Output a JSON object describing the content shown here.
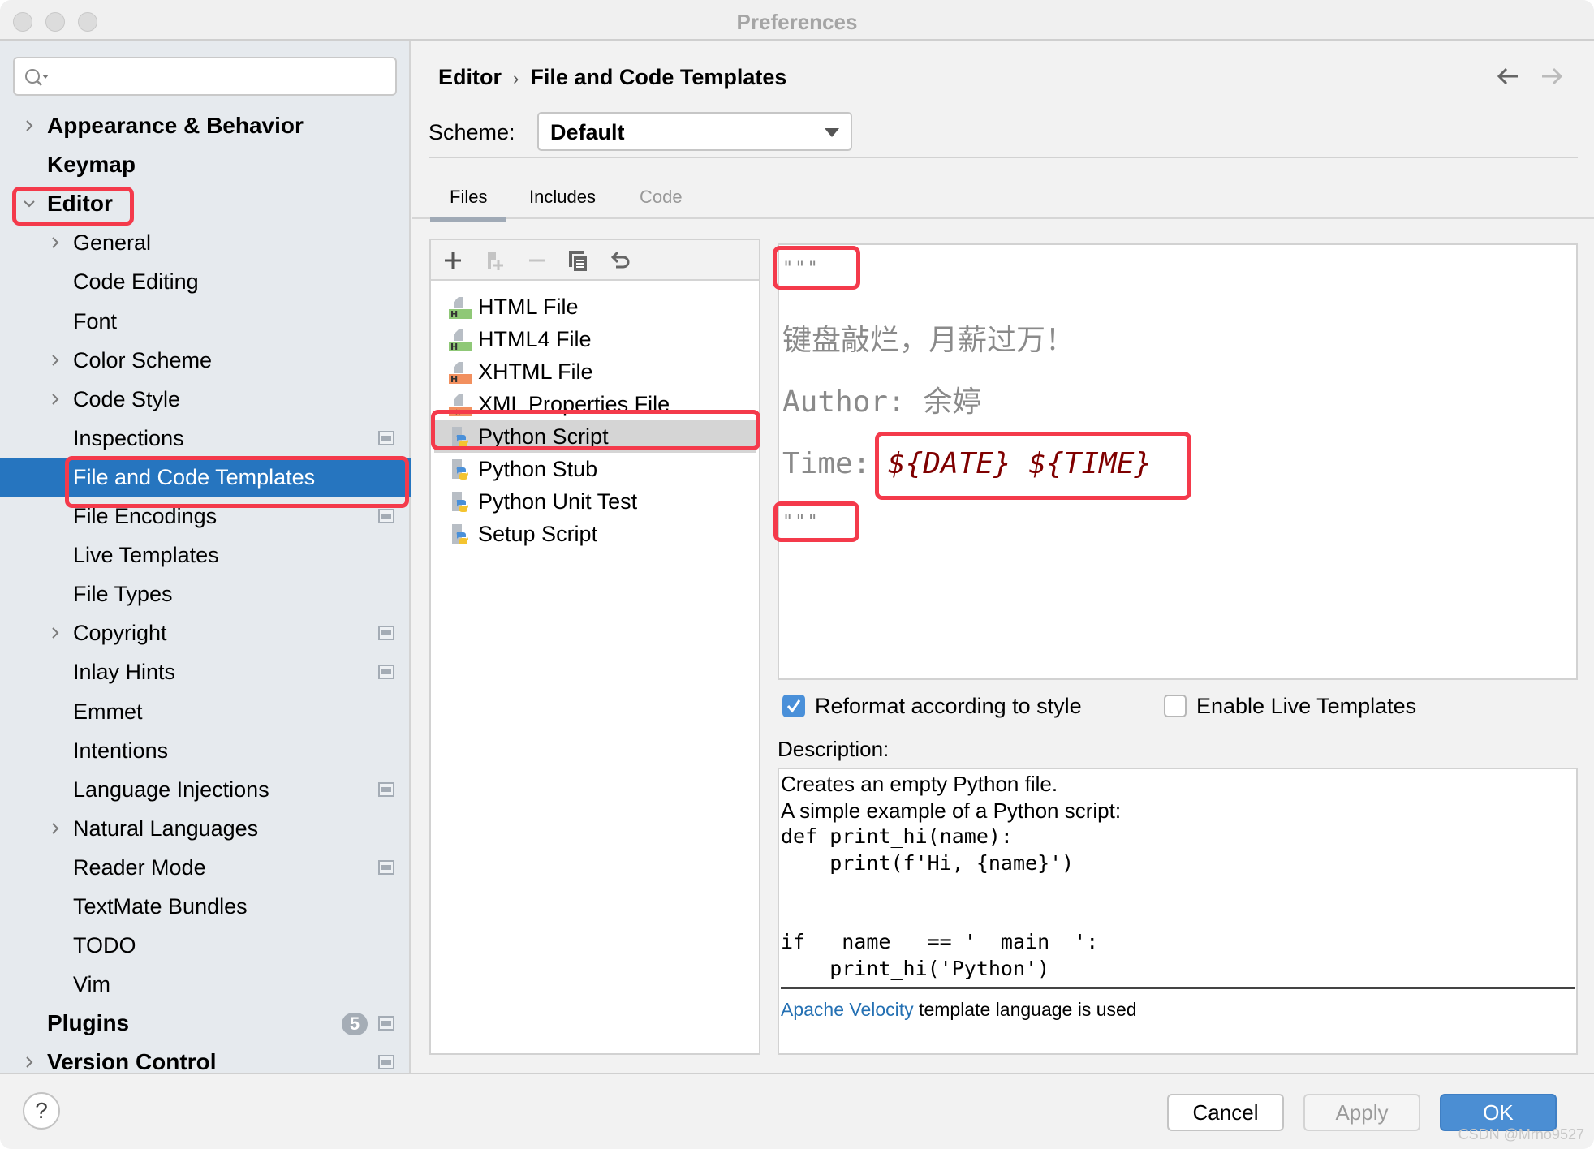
{
  "window": {
    "title": "Preferences"
  },
  "search": {
    "placeholder": "",
    "value": ""
  },
  "sidebar": {
    "items": [
      {
        "label": "Appearance & Behavior",
        "level": 0,
        "expandable": true,
        "expanded": false,
        "scope": false
      },
      {
        "label": "Keymap",
        "level": 0,
        "expandable": false,
        "scope": false
      },
      {
        "label": "Editor",
        "level": 0,
        "expandable": true,
        "expanded": true,
        "scope": false
      },
      {
        "label": "General",
        "level": 1,
        "expandable": true,
        "expanded": false,
        "scope": false
      },
      {
        "label": "Code Editing",
        "level": 1,
        "expandable": false,
        "scope": false
      },
      {
        "label": "Font",
        "level": 1,
        "expandable": false,
        "scope": false
      },
      {
        "label": "Color Scheme",
        "level": 1,
        "expandable": true,
        "expanded": false,
        "scope": false
      },
      {
        "label": "Code Style",
        "level": 1,
        "expandable": true,
        "expanded": false,
        "scope": false
      },
      {
        "label": "Inspections",
        "level": 1,
        "expandable": false,
        "scope": true
      },
      {
        "label": "File and Code Templates",
        "level": 1,
        "expandable": false,
        "scope": false,
        "selected": true
      },
      {
        "label": "File Encodings",
        "level": 1,
        "expandable": false,
        "scope": true
      },
      {
        "label": "Live Templates",
        "level": 1,
        "expandable": false,
        "scope": false
      },
      {
        "label": "File Types",
        "level": 1,
        "expandable": false,
        "scope": false
      },
      {
        "label": "Copyright",
        "level": 1,
        "expandable": true,
        "expanded": false,
        "scope": true
      },
      {
        "label": "Inlay Hints",
        "level": 1,
        "expandable": false,
        "scope": true
      },
      {
        "label": "Emmet",
        "level": 1,
        "expandable": false,
        "scope": false
      },
      {
        "label": "Intentions",
        "level": 1,
        "expandable": false,
        "scope": false
      },
      {
        "label": "Language Injections",
        "level": 1,
        "expandable": false,
        "scope": true
      },
      {
        "label": "Natural Languages",
        "level": 1,
        "expandable": true,
        "expanded": false,
        "scope": false
      },
      {
        "label": "Reader Mode",
        "level": 1,
        "expandable": false,
        "scope": true
      },
      {
        "label": "TextMate Bundles",
        "level": 1,
        "expandable": false,
        "scope": false
      },
      {
        "label": "TODO",
        "level": 1,
        "expandable": false,
        "scope": false
      },
      {
        "label": "Vim",
        "level": 1,
        "expandable": false,
        "scope": false
      },
      {
        "label": "Plugins",
        "level": 0,
        "expandable": false,
        "scope": true,
        "badge": "5"
      },
      {
        "label": "Version Control",
        "level": 0,
        "expandable": true,
        "expanded": false,
        "scope": true
      }
    ]
  },
  "header": {
    "breadcrumb": [
      "Editor",
      "File and Code Templates"
    ],
    "breadcrumb_separator": "›",
    "back_icon": "arrow-left-icon",
    "forward_icon": "arrow-right-icon"
  },
  "scheme": {
    "label": "Scheme:",
    "value": "Default"
  },
  "tabs": [
    {
      "label": "Files",
      "active": true,
      "enabled": true
    },
    {
      "label": "Includes",
      "active": false,
      "enabled": true
    },
    {
      "label": "Code",
      "active": false,
      "enabled": false
    }
  ],
  "toolbar": {
    "icons": [
      "add-icon",
      "add-child-icon",
      "remove-icon",
      "copy-icon",
      "reset-icon"
    ]
  },
  "templates": [
    {
      "label": "HTML File",
      "icon": "html",
      "selected": false
    },
    {
      "label": "HTML4 File",
      "icon": "html",
      "selected": false
    },
    {
      "label": "XHTML File",
      "icon": "xhtml",
      "selected": false
    },
    {
      "label": "XML Properties File",
      "icon": "xml",
      "selected": false
    },
    {
      "label": "Python Script",
      "icon": "python",
      "selected": true
    },
    {
      "label": "Python Stub",
      "icon": "python",
      "selected": false
    },
    {
      "label": "Python Unit Test",
      "icon": "python",
      "selected": false
    },
    {
      "label": "Setup Script",
      "icon": "python",
      "selected": false
    }
  ],
  "editor": {
    "lines": [
      {
        "text": "\"\"\""
      },
      {
        "text": ""
      },
      {
        "text": "键盘敲烂，月薪过万！"
      },
      {
        "text": ""
      },
      {
        "text": "Author: 余婷"
      },
      {
        "text": ""
      },
      {
        "prefix": "Time: ",
        "var": "${DATE} ${TIME}"
      },
      {
        "text": "\"\"\""
      }
    ]
  },
  "options": {
    "reformat": {
      "label": "Reformat according to style",
      "checked": true
    },
    "live_templates": {
      "label": "Enable Live Templates",
      "checked": false
    }
  },
  "description": {
    "label": "Description:",
    "lines": [
      "Creates an empty Python file.",
      "A simple example of a Python script:",
      "def print_hi(name):",
      "    print(f'Hi, {name}')",
      "",
      "",
      "if __name__ == '__main__':",
      "    print_hi('Python')"
    ],
    "footer_link": "Apache Velocity",
    "footer_text": " template language is used"
  },
  "buttons": {
    "help": "?",
    "cancel": "Cancel",
    "apply": "Apply",
    "ok": "OK"
  },
  "watermark": "CSDN @Mrno9527",
  "colors": {
    "selection": "#2675bf",
    "highlight_annotation": "#f43a4b",
    "ok_button": "#4b8ed3",
    "template_variable": "#7f0000",
    "link": "#2470b3"
  }
}
